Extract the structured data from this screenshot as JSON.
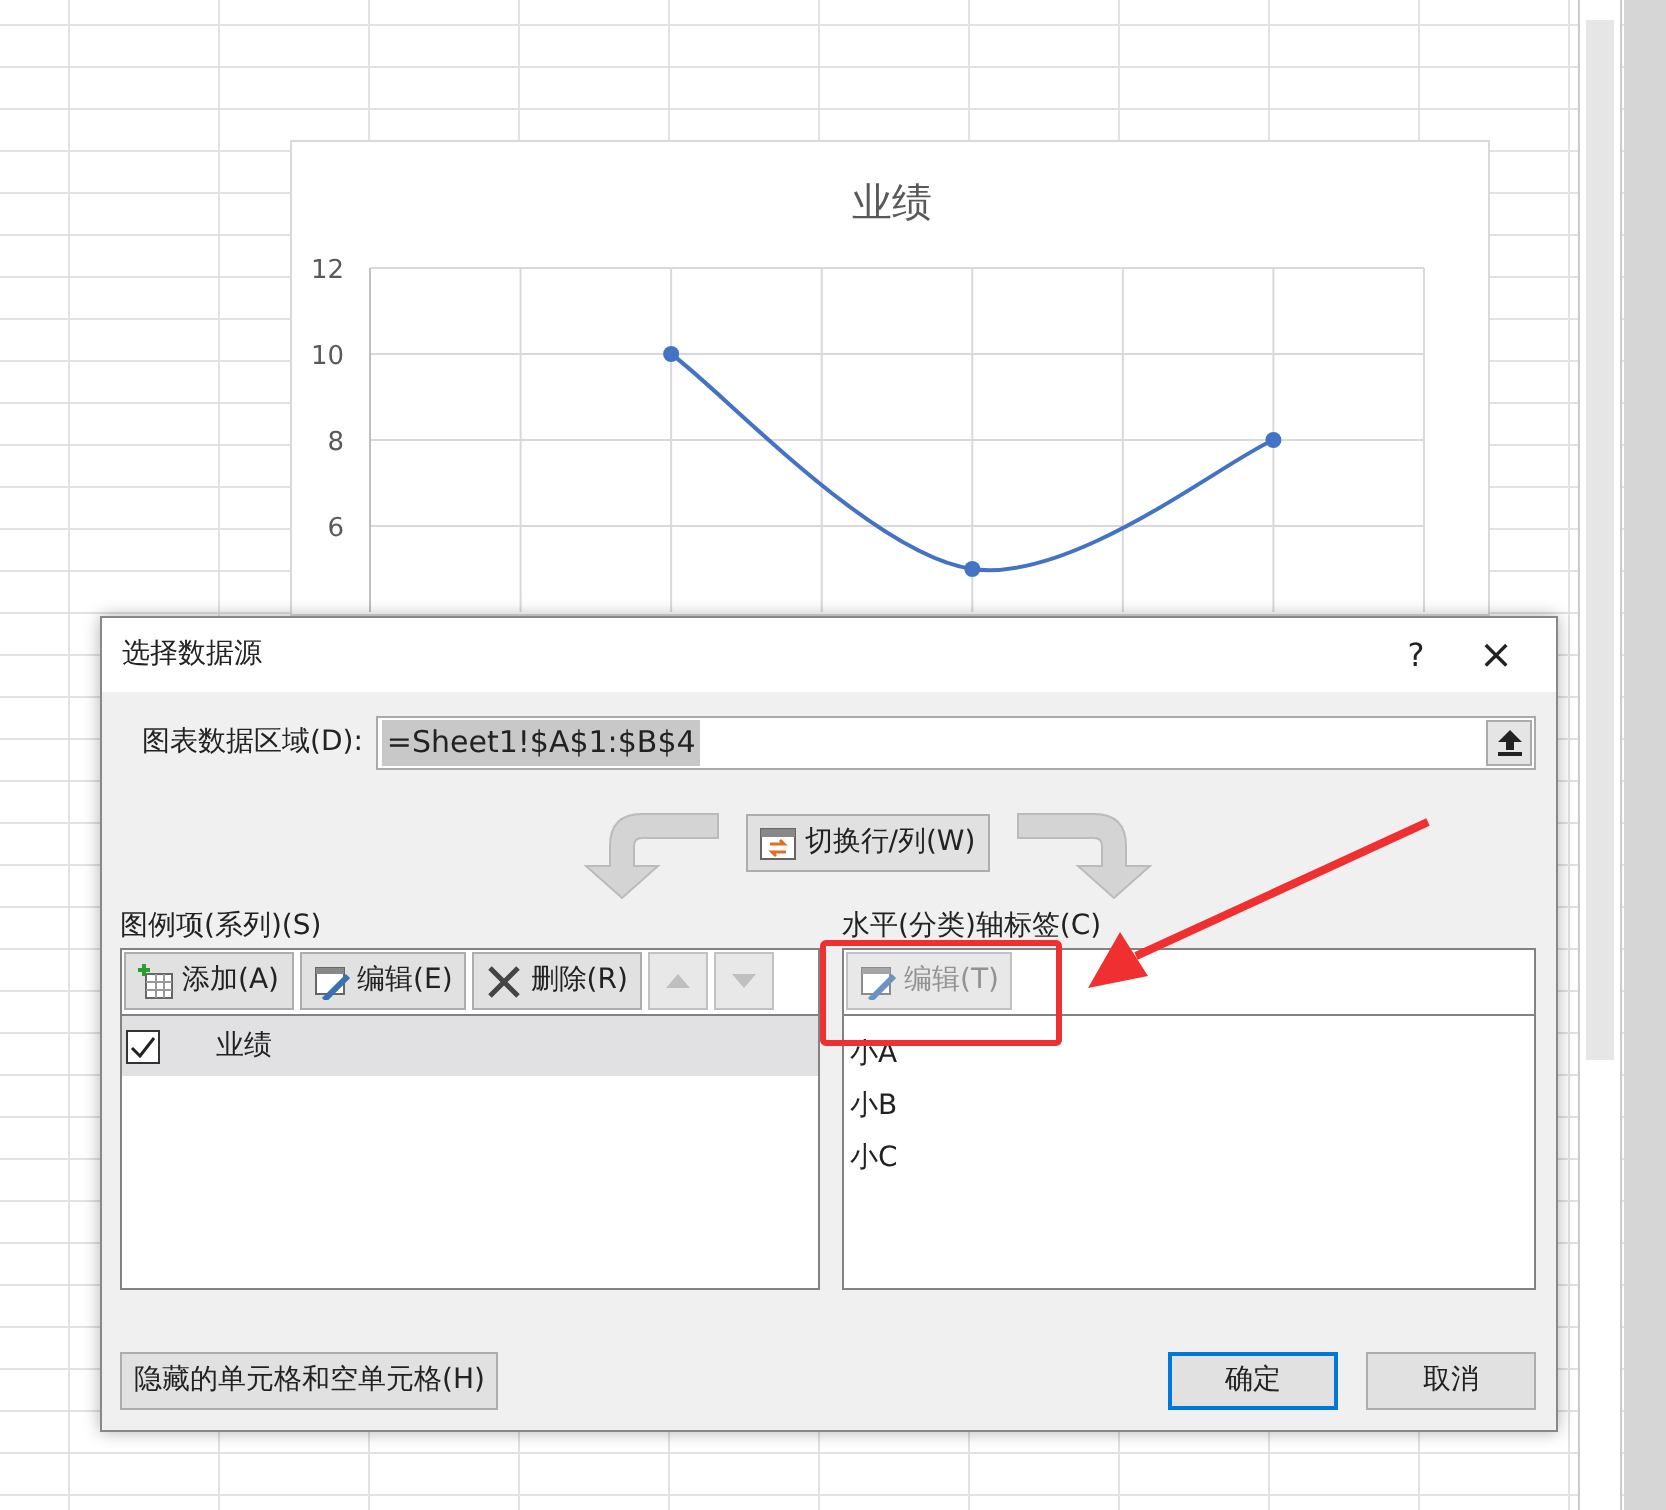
{
  "chart": {
    "chart_data": {
      "type": "line",
      "title": "业绩",
      "categories": [
        null,
        null,
        null
      ],
      "yticks": [
        6,
        8,
        10,
        12
      ],
      "ylim": [
        4,
        12
      ],
      "grid": true,
      "series": [
        {
          "color": "#4472c4",
          "marker": "circle",
          "values": [
            10,
            5,
            8
          ]
        }
      ]
    }
  },
  "dialog": {
    "title": "选择数据源",
    "help": "?",
    "close": "×",
    "range_label": "图表数据区域(D):",
    "range_value": "=Sheet1!$A$1:$B$4",
    "range_highlighted": true,
    "switch_button": "切换行/列(W)",
    "legend_label": "图例项(系列)(S)",
    "legend_buttons": [
      {
        "kind": "add",
        "label": "添加(A)",
        "disabled": false
      },
      {
        "kind": "edit",
        "label": "编辑(E)",
        "disabled": false
      },
      {
        "kind": "delete",
        "label": "删除(R)",
        "disabled": false
      },
      {
        "kind": "up",
        "disabled": true
      },
      {
        "kind": "down",
        "disabled": true
      }
    ],
    "series": [
      {
        "label": "业绩",
        "checked": true,
        "selected": true
      }
    ],
    "axis_label": "水平(分类)轴标签(C)",
    "axis_buttons": [
      {
        "kind": "edit",
        "label": "编辑(T)",
        "disabled": true
      }
    ],
    "categories": [
      {
        "label": "小A"
      },
      {
        "label": "小B"
      },
      {
        "label": "小C"
      }
    ],
    "hidden_cells_button": "隐藏的单元格和空单元格(H)",
    "footer_buttons": [
      {
        "label": "确定",
        "default": true
      },
      {
        "label": "取消",
        "default": false
      }
    ]
  }
}
